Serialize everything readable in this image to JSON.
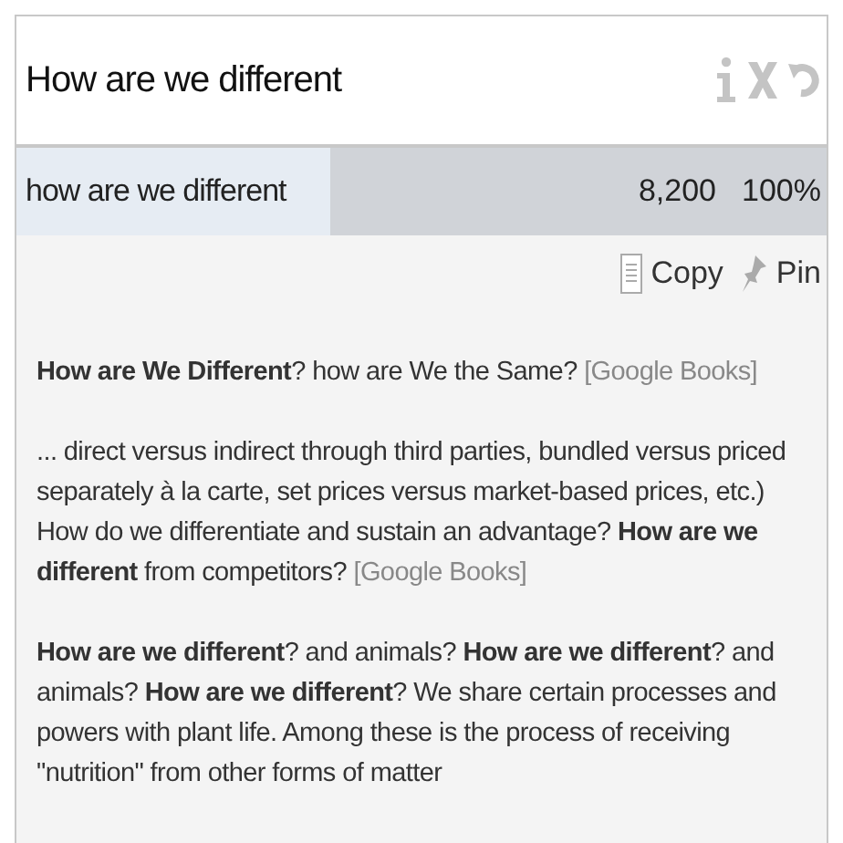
{
  "header": {
    "title": "How are we different"
  },
  "result": {
    "query": "how are we different",
    "count": "8,200",
    "share": "100%"
  },
  "actions": [
    "Copy",
    "Pin"
  ],
  "snippets": [
    {
      "text": "**How are We Different**? how are We the Same?",
      "source": "[Google Books]"
    },
    {
      "text": "... direct versus indirect through third parties, bundled versus priced separately à la carte, set prices versus market-based prices, etc.) How do we differentiate and sustain an advantage? **How are we different** from competitors?",
      "source": "[Google Books]"
    },
    {
      "text": "**How are we different**? and animals? **How are we different**? and animals? **How are we different**? We share certain processes and powers with plant life. Among these is the process of receiving \"nutrition\" from other forms of matter"
    }
  ]
}
